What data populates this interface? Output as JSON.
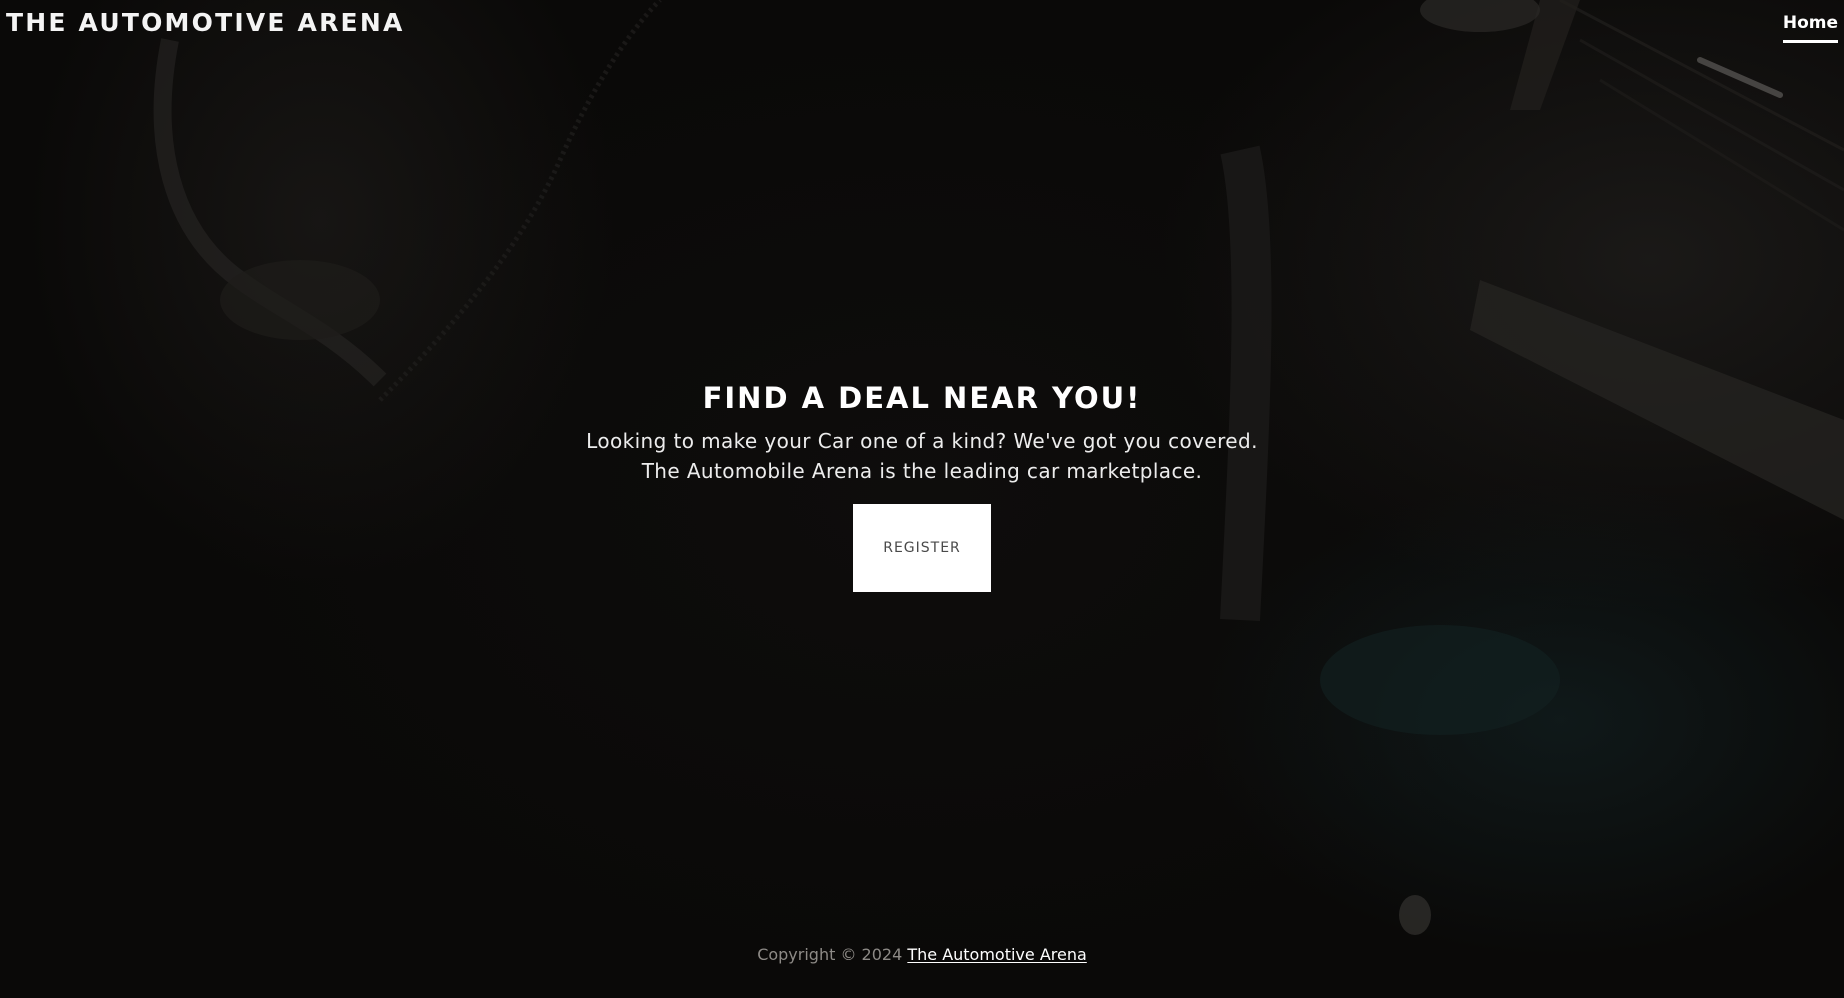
{
  "header": {
    "brand": "THE AUTOMOTIVE ARENA",
    "nav": [
      {
        "label": "Home",
        "active": true
      }
    ]
  },
  "hero": {
    "title": "FIND A DEAL NEAR YOU!",
    "line1": "Looking to make your Car one of a kind? We've got you covered.",
    "line2": "The Automobile Arena is the leading car marketplace.",
    "register_label": "REGISTER"
  },
  "footer": {
    "copyright": "Copyright © 2024",
    "link_label": "The Automotive Arena"
  },
  "colors": {
    "background": "#0b0a09",
    "text": "#ffffff",
    "footer_text": "#8d8a86",
    "button_bg": "#ffffff",
    "button_text": "#4a4a4a"
  }
}
